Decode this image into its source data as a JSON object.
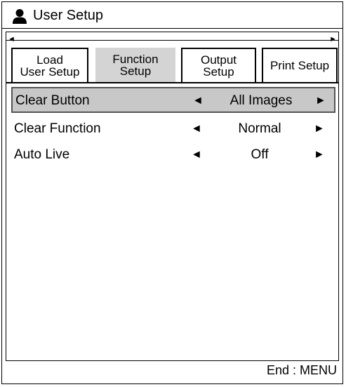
{
  "window": {
    "title": "User Setup",
    "icon": "user-icon"
  },
  "tabs": [
    {
      "line1": "Load",
      "line2": "User Setup",
      "active": false
    },
    {
      "line1": "Function",
      "line2": "Setup",
      "active": true
    },
    {
      "line1": "Output",
      "line2": "Setup",
      "active": false
    },
    {
      "line1": "Print Setup",
      "line2": "",
      "active": false
    }
  ],
  "tab_scroll": {
    "left": "◄",
    "right": "►"
  },
  "settings": [
    {
      "label": "Clear Button",
      "value": "All Images",
      "selected": true
    },
    {
      "label": "Clear Function",
      "value": "Normal",
      "selected": false
    },
    {
      "label": "Auto Live",
      "value": "Off",
      "selected": false
    }
  ],
  "arrows": {
    "left": "◄",
    "right": "►"
  },
  "footer": {
    "hint": "End : MENU"
  }
}
